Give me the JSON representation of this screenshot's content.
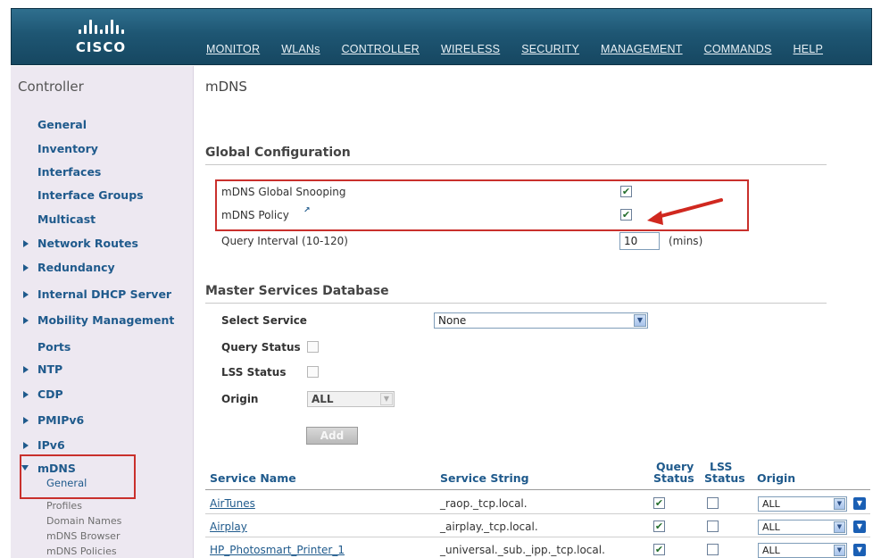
{
  "header": {
    "logo_text": "CISCO",
    "nav": [
      "MONITOR",
      "WLANs",
      "CONTROLLER",
      "WIRELESS",
      "SECURITY",
      "MANAGEMENT",
      "COMMANDS",
      "HELP"
    ]
  },
  "sidebar": {
    "title": "Controller",
    "items": [
      "General",
      "Inventory",
      "Interfaces",
      "Interface Groups",
      "Multicast",
      "Network Routes",
      "Redundancy",
      "Internal DHCP Server",
      "Mobility Management",
      "Ports",
      "NTP",
      "CDP",
      "PMIPv6",
      "IPv6",
      "mDNS"
    ],
    "mdns_sub": [
      "General",
      "Profiles",
      "Domain Names",
      "mDNS Browser",
      "mDNS Policies"
    ]
  },
  "main": {
    "title": "mDNS",
    "global": {
      "heading": "Global Configuration",
      "snooping_label": "mDNS Global Snooping",
      "snooping_checked": true,
      "policy_label": "mDNS Policy",
      "policy_checked": true,
      "query_interval_label": "Query Interval (10-120)",
      "query_interval_value": "10",
      "query_interval_unit": "(mins)"
    },
    "msd": {
      "heading": "Master Services Database",
      "select_service_label": "Select Service",
      "select_service_value": "None",
      "query_status_label": "Query Status",
      "lss_status_label": "LSS Status",
      "origin_label": "Origin",
      "origin_value": "ALL",
      "add_label": "Add"
    },
    "table": {
      "headers": {
        "service_name": "Service Name",
        "service_string": "Service String",
        "query_status_1": "Query",
        "query_status_2": "Status",
        "lss_status_1": "LSS",
        "lss_status_2": "Status",
        "origin": "Origin"
      },
      "rows": [
        {
          "name": "AirTunes",
          "string": "_raop._tcp.local.",
          "query": true,
          "lss": false,
          "origin": "ALL"
        },
        {
          "name": "Airplay",
          "string": "_airplay._tcp.local.",
          "query": true,
          "lss": false,
          "origin": "ALL"
        },
        {
          "name": "HP_Photosmart_Printer_1",
          "string": "_universal._sub._ipp._tcp.local.",
          "query": true,
          "lss": false,
          "origin": "ALL"
        }
      ]
    }
  },
  "colors": {
    "header_bg": "#1e5673",
    "link_blue": "#1f5a8c",
    "highlight_red": "#c9302c",
    "sidebar_bg": "#ede8f1"
  }
}
